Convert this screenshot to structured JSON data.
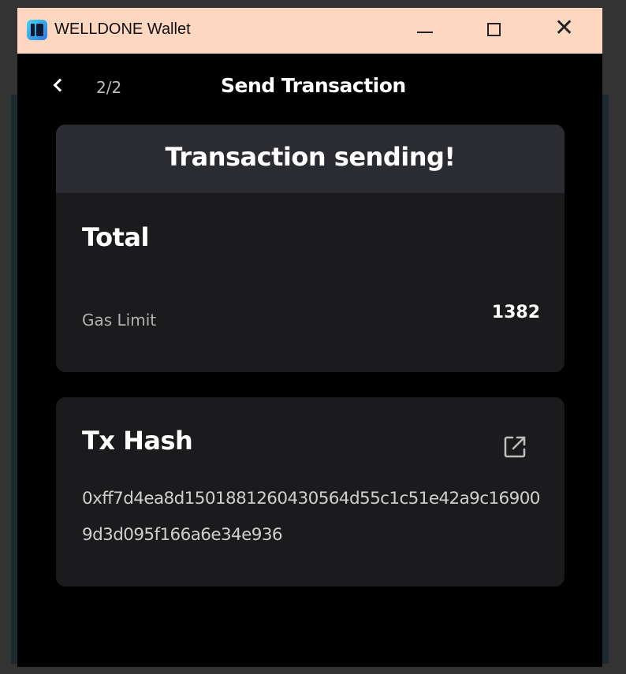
{
  "window": {
    "title": "WELLDONE Wallet",
    "titlebar_color": "#fdd7c0",
    "app_icon": "welldone-logo-icon",
    "controls": {
      "minimize_icon": "minimize-icon",
      "maximize_icon": "maximize-icon",
      "close_icon": "close-icon",
      "close_glyph": "✕"
    }
  },
  "header": {
    "back_icon": "chevron-left-icon",
    "step": "2/2",
    "title": "Send Transaction"
  },
  "status": {
    "message": "Transaction sending!",
    "banner_color": "#2a2c31"
  },
  "summary": {
    "total_label": "Total",
    "gas_limit_label": "Gas Limit",
    "gas_limit_value": "1382"
  },
  "tx_hash": {
    "label": "Tx Hash",
    "link_icon": "external-link-icon",
    "value": "0xff7d4ea8d1501881260430564d55c1c51e42a9c169009d3d095f166a6e34e936"
  },
  "colors": {
    "background": "#000000",
    "card": "#1b1b1d",
    "text_primary": "#ffffff",
    "text_secondary": "#b3b3b3"
  }
}
